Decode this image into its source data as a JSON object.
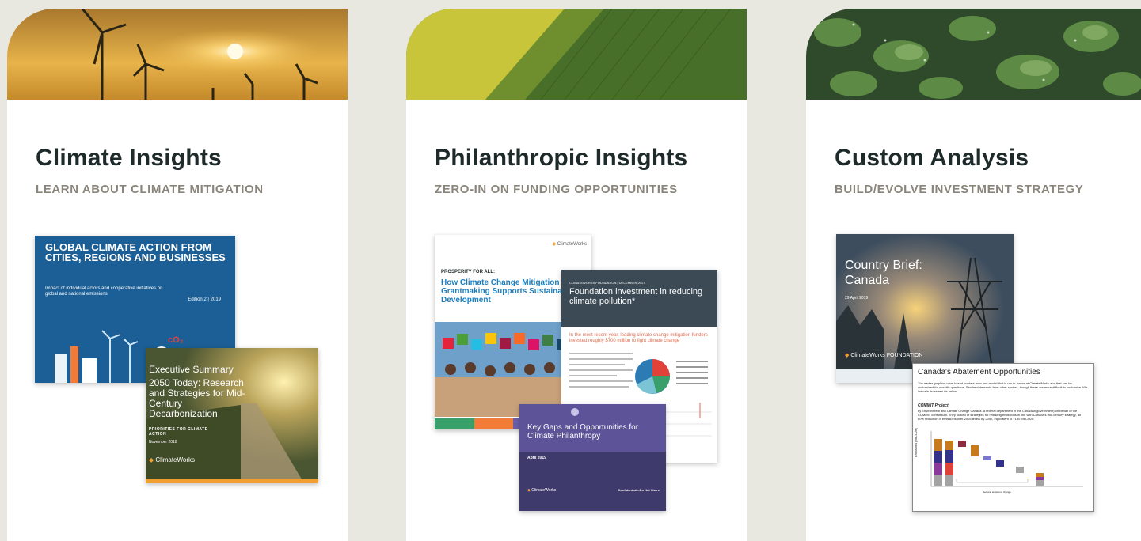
{
  "cards": [
    {
      "title": "Climate Insights",
      "subtitle": "LEARN ABOUT CLIMATE MITIGATION",
      "docs": {
        "gca_title": "GLOBAL CLIMATE ACTION FROM CITIES, REGIONS AND BUSINESSES",
        "gca_sub": "Impact of individual actors and cooperative initiatives on global and national emissions",
        "gca_edition": "Edition 2 | 2019",
        "es_label": "Executive Summary",
        "es_title": "2050 Today: Research and Strategies for Mid-Century Decarbonization",
        "es_tagline": "PRIORITIES FOR CLIMATE ACTION",
        "es_date": "November 2018",
        "es_logo": "ClimateWorks"
      }
    },
    {
      "title": "Philanthropic Insights",
      "subtitle": "ZERO-IN ON FUNDING OPPORTUNITIES",
      "docs": {
        "pfa_logo": "ClimateWorks",
        "pfa_kicker": "PROSPERITY FOR ALL:",
        "pfa_title": "How Climate Change Mitigation Grantmaking Supports Sustainable Development",
        "fi_kicker": "CLIMATEWORKS FOUNDATION | DECEMBER 2017",
        "fi_title": "Foundation investment in reducing climate pollution*",
        "fi_quote": "In the most recent year, leading climate change mitigation funders invested roughly $700 million to fight climate change",
        "kg_title": "Key Gaps and Opportunities for Climate Philanthropy",
        "kg_date": "April 2019",
        "kg_logo": "ClimateWorks",
        "kg_conf": "Confidential—Do Not Share"
      }
    },
    {
      "title": "Custom Analysis",
      "subtitle": "BUILD/EVOLVE INVESTMENT STRATEGY",
      "docs": {
        "cb_title": "Country Brief: Canada",
        "cb_date": "29 April 2019",
        "cb_logo": "ClimateWorks FOUNDATION",
        "ca_title": "Canada's Abatement Opportunities",
        "ca_para": "The earlier graphics were based on data from one model that is run in-house at ClimateWorks and that can be customized for specific questions. Similar data exists from other studies, though these are more difficult to customize. We indicate those results below.",
        "ca_heading": "COMMIT Project",
        "ca_para2": "by Environment and Climate Change Canada (a federal department in the Canadian government) on behalf of the COMMIT consortium. They looked at strategies for reducing emissions in line with Canada's mid-century strategy, an 80% reduction in emissions over 2005 levels by 2050, equivalent to ~150 Mt CO2e.",
        "ca_ylabel": "Emissions [MtCO2e]",
        "ca_legend": "Sectoral emissions change"
      }
    }
  ],
  "colors": {
    "background": "#e9e8e0",
    "card": "#ffffff",
    "title": "#1f2a2a",
    "subtitle": "#8a857b"
  }
}
